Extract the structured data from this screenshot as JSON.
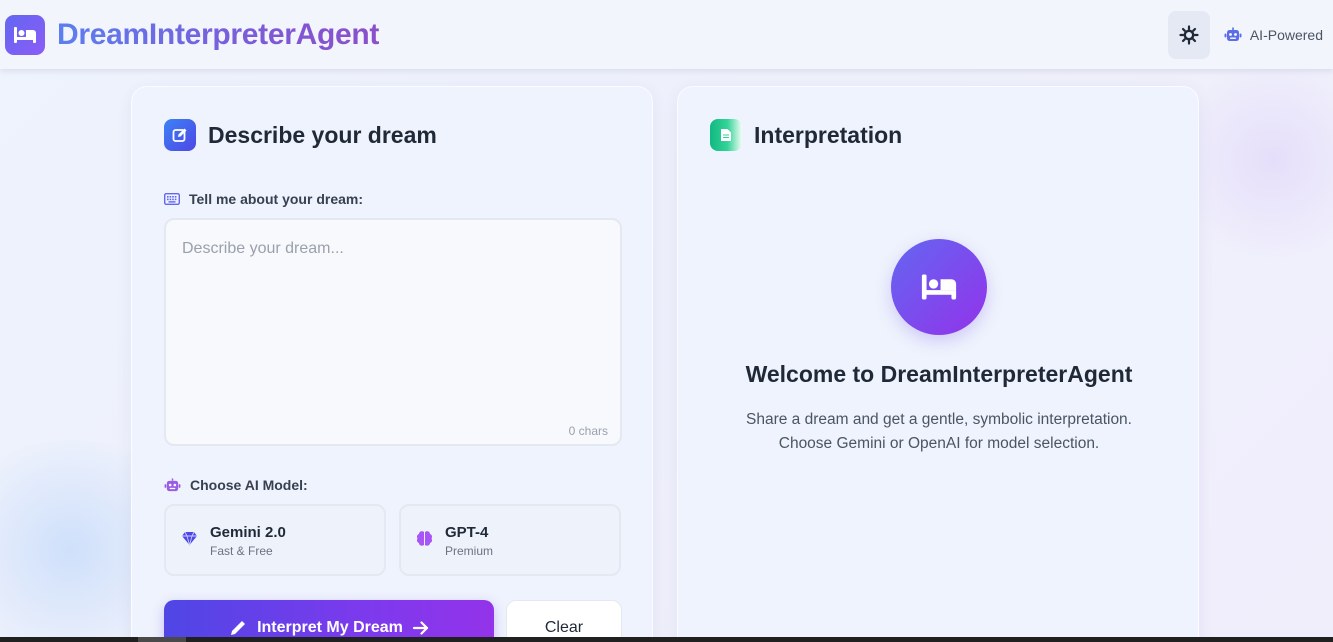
{
  "header": {
    "app_title": "DreamInterpreterAgent",
    "logo_icon": "bed-icon",
    "theme_toggle_icon": "sun-icon",
    "badge_icon": "robot-icon",
    "badge_label": "AI-Powered"
  },
  "input_panel": {
    "title": "Describe your dream",
    "title_icon": "edit-icon",
    "dream_label": "Tell me about your dream:",
    "dream_label_icon": "keyboard-icon",
    "dream_placeholder": "Describe your dream...",
    "char_count": "0 chars",
    "model_label": "Choose AI Model:",
    "model_label_icon": "robot-icon",
    "models": [
      {
        "name": "Gemini 2.0",
        "subtitle": "Fast & Free",
        "icon": "gem-icon",
        "color": "#4f46e5"
      },
      {
        "name": "GPT-4",
        "subtitle": "Premium",
        "icon": "brain-icon",
        "color": "#a855f7"
      }
    ],
    "interpret_button": "Interpret My Dream",
    "clear_button": "Clear"
  },
  "output_panel": {
    "title": "Interpretation",
    "title_icon": "document-icon",
    "welcome_icon": "bed-icon",
    "welcome_title": "Welcome to DreamInterpreterAgent",
    "welcome_line1": "Share a dream and get a gentle, symbolic interpretation.",
    "welcome_line2": "Choose Gemini or OpenAI for model selection."
  },
  "colors": {
    "accent_indigo": "#4f46e5",
    "accent_purple": "#9333ea",
    "accent_green": "#10b981",
    "accent_blue": "#3b82f6"
  }
}
